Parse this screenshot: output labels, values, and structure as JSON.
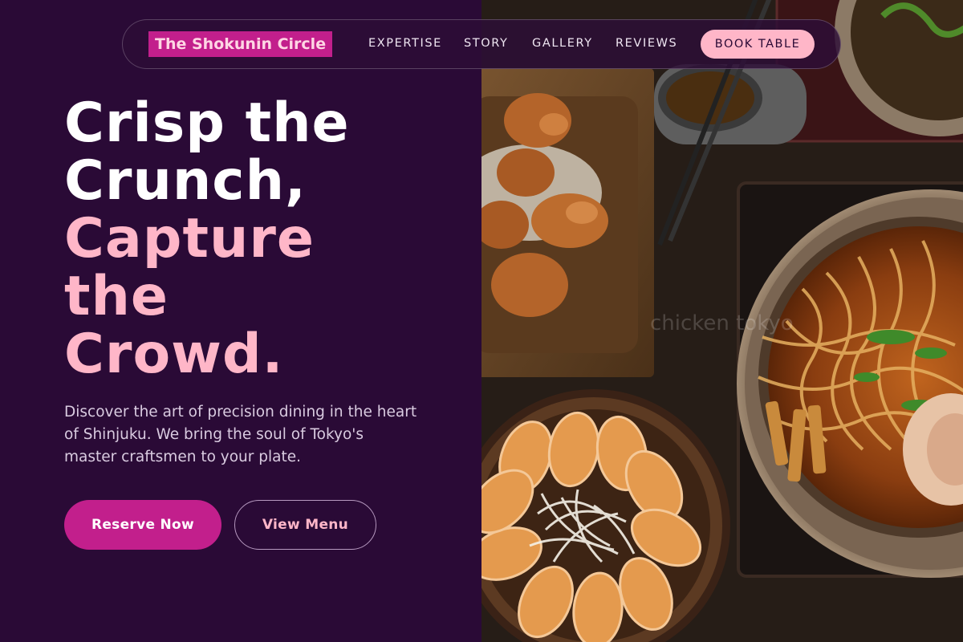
{
  "brand": {
    "name": "The Shokunin Circle"
  },
  "nav": {
    "links": [
      "EXPERTISE",
      "STORY",
      "GALLERY",
      "REVIEWS"
    ],
    "cta": "BOOK TABLE"
  },
  "hero": {
    "headline_white_1": "Crisp the",
    "headline_white_2": "Crunch,",
    "headline_pink_1": "Capture",
    "headline_pink_2": "the",
    "headline_pink_3": "Crowd.",
    "subtext": "Discover the art of precision dining in the heart of Shinjuku. We bring the soul of Tokyo's master craftsmen to your plate.",
    "primary_button": "Reserve Now",
    "secondary_button": "View Menu"
  },
  "image": {
    "watermark": "chicken tokyo"
  },
  "colors": {
    "background": "#2a0a36",
    "accent_magenta": "#c21f8c",
    "accent_pink": "#ffb6c8",
    "text_white": "#ffffff"
  }
}
